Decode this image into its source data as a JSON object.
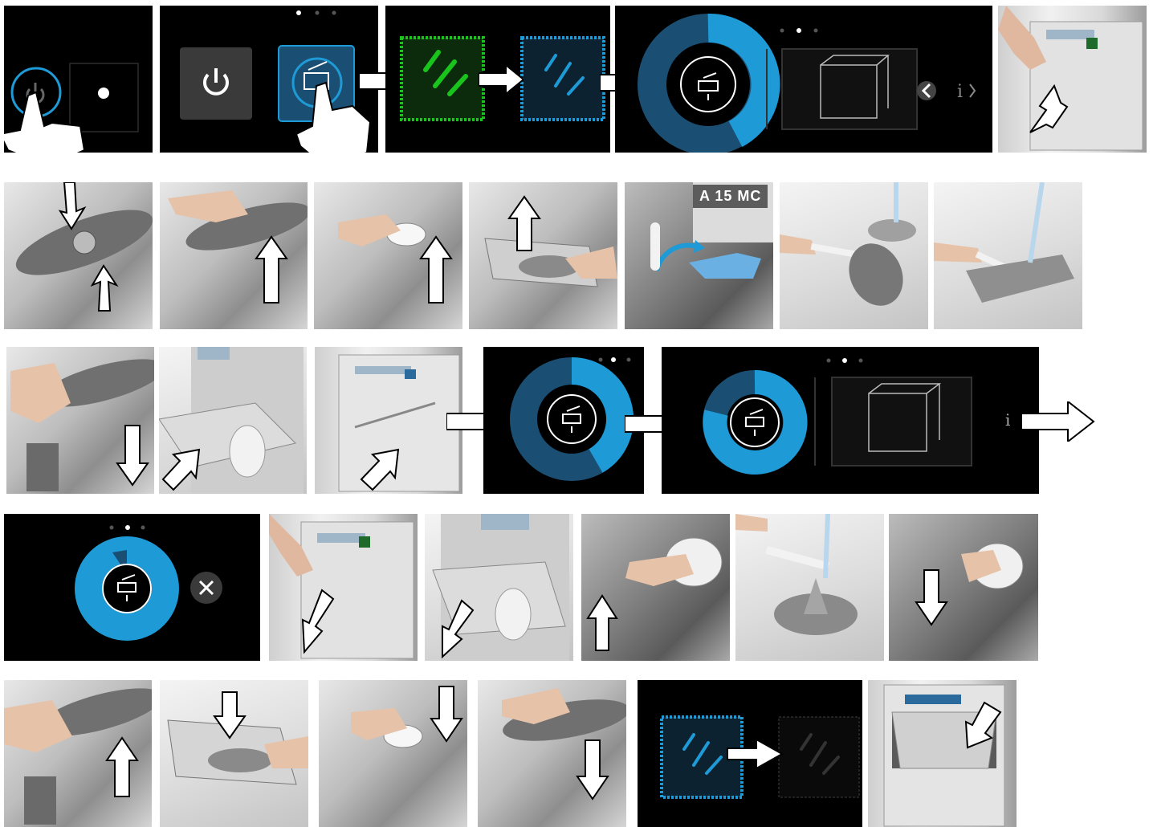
{
  "labels": {
    "detergent_label": "A 15 MC",
    "info_button": "i"
  },
  "colors": {
    "accent_blue": "#1e9ad6",
    "dark_blue": "#1a4f73",
    "green_active": "#19c41c",
    "panel_black": "#000000"
  },
  "icons": {
    "power": "power-icon",
    "self_clean": "self-clean-program-icon",
    "spray_arms": "spray-arms-icon",
    "close": "close-icon",
    "info": "info-icon",
    "chevron": "chevron-left-icon"
  }
}
